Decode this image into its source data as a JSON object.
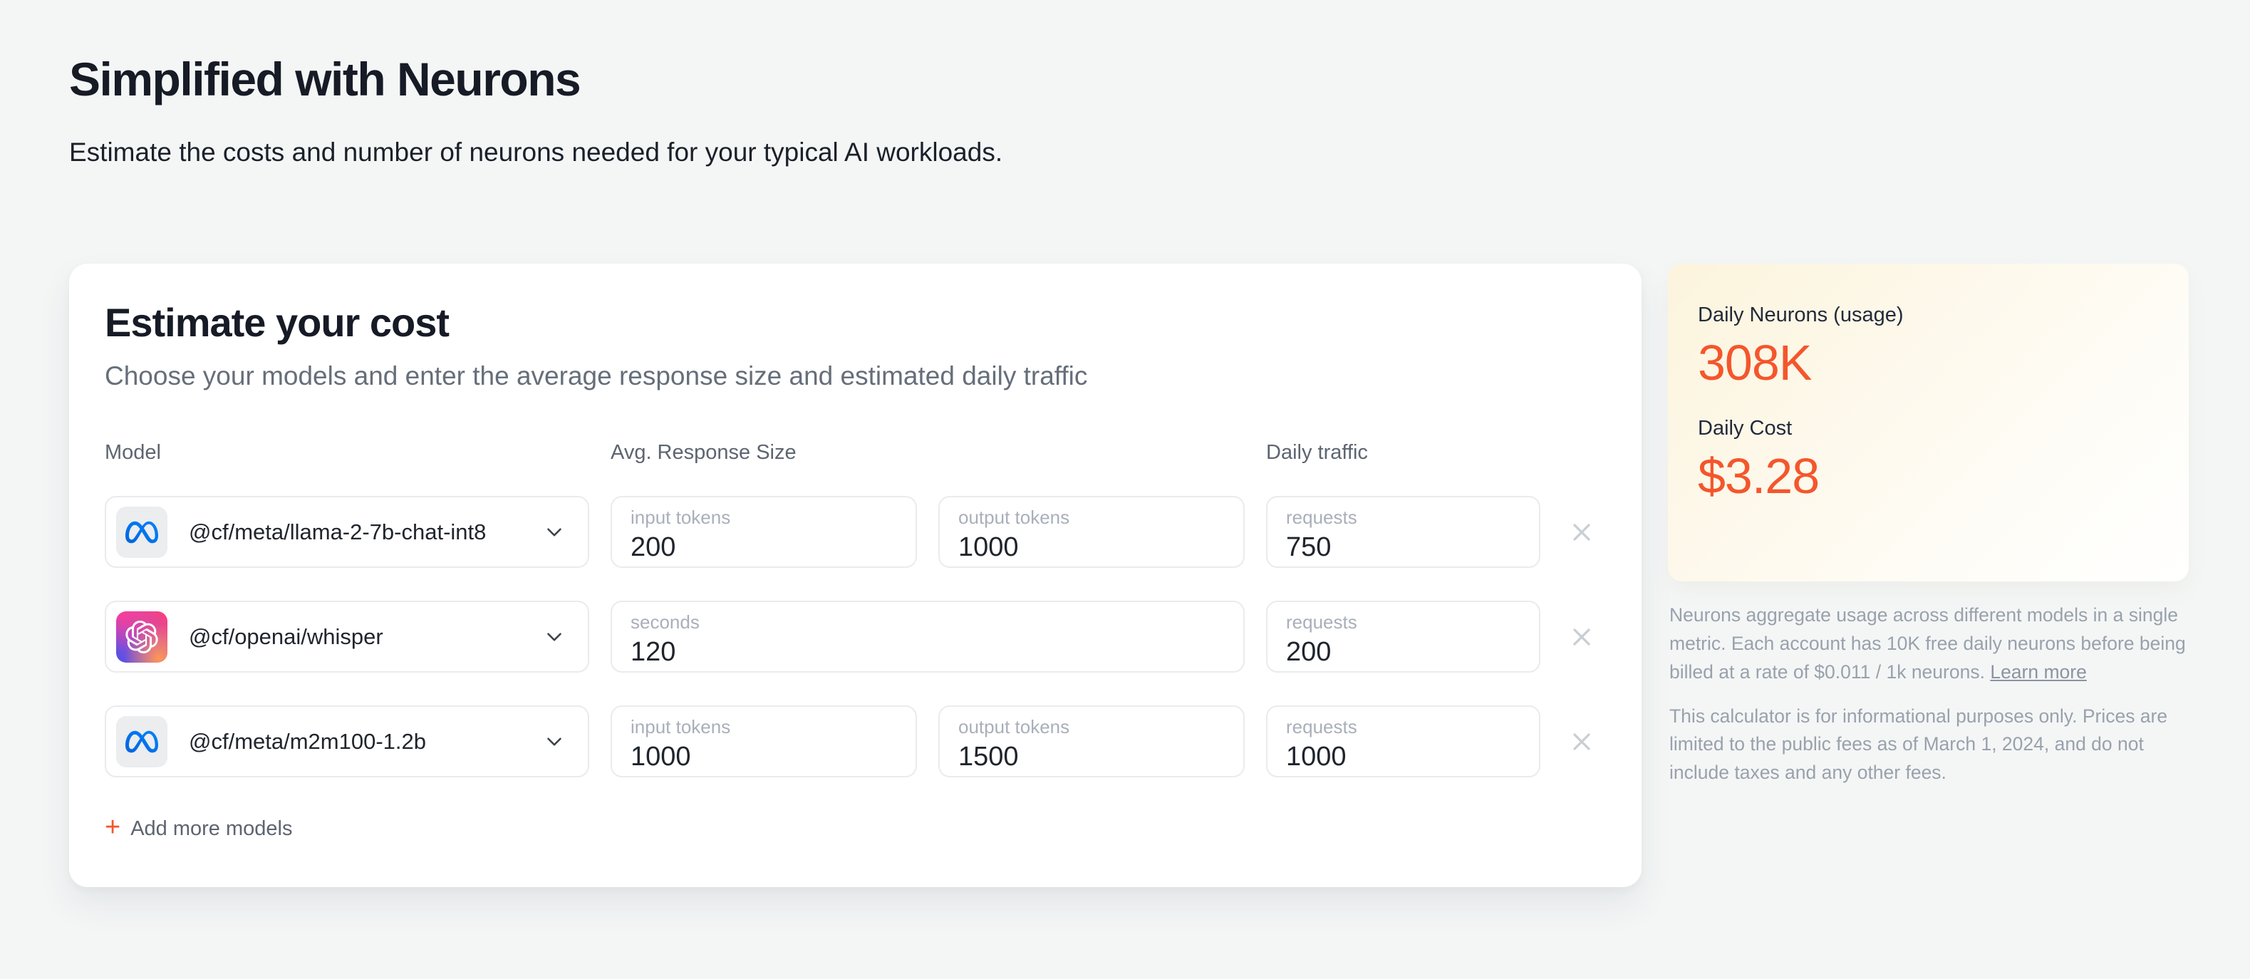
{
  "page": {
    "title": "Simplified with Neurons",
    "subtitle": "Estimate the costs and number of neurons needed for your typical AI workloads."
  },
  "calculator": {
    "title": "Estimate your cost",
    "subtitle": "Choose your models and enter the average response size and estimated daily traffic",
    "columns": {
      "model": "Model",
      "avg_response": "Avg. Response Size",
      "daily_traffic": "Daily traffic"
    },
    "rows": [
      {
        "icon": "meta-icon",
        "model": "@cf/meta/llama-2-7b-chat-int8",
        "fields": [
          {
            "label": "input tokens",
            "value": "200"
          },
          {
            "label": "output tokens",
            "value": "1000"
          }
        ],
        "traffic": {
          "label": "requests",
          "value": "750"
        }
      },
      {
        "icon": "openai-icon",
        "model": "@cf/openai/whisper",
        "fields": [
          {
            "label": "seconds",
            "value": "120"
          }
        ],
        "traffic": {
          "label": "requests",
          "value": "200"
        }
      },
      {
        "icon": "meta-icon",
        "model": "@cf/meta/m2m100-1.2b",
        "fields": [
          {
            "label": "input tokens",
            "value": "1000"
          },
          {
            "label": "output tokens",
            "value": "1500"
          }
        ],
        "traffic": {
          "label": "requests",
          "value": "1000"
        }
      }
    ],
    "add_more_label": "Add more models",
    "add_more_plus": "+"
  },
  "summary": {
    "neurons_label": "Daily Neurons (usage)",
    "neurons_value": "308K",
    "cost_label": "Daily Cost",
    "cost_value": "$3.28",
    "note1": "Neurons aggregate usage across different models in a single metric. Each account has 10K free daily neurons before being billed at a rate of $0.011 / 1k neurons.",
    "learn_more_label": "Learn more",
    "note2": "This calculator is for informational purposes only. Prices are limited to the public fees as of March 1, 2024, and do not include taxes and any other fees."
  },
  "colors": {
    "accent_orange": "#f4562c",
    "meta_blue": "#0064E0",
    "page_background": "#f4f6f6",
    "summary_card_tint": "#fcf4dc"
  }
}
